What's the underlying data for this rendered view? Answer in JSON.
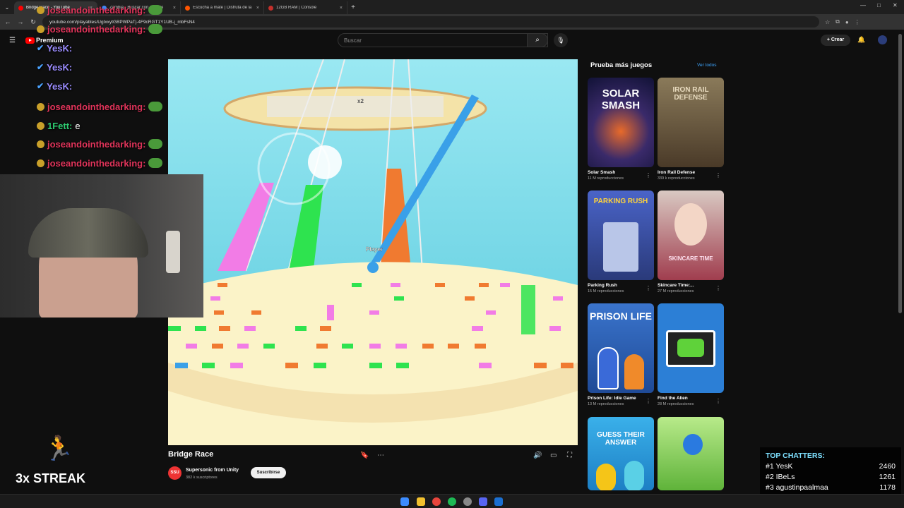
{
  "browser": {
    "tabs": [
      {
        "label": "Bridge Race - YouTube",
        "color": "#ff0000",
        "active": true
      },
      {
        "label": "Zambia - Buscar con Google",
        "color": "#4285f4",
        "active": false
      },
      {
        "label": "Escucha a mate | Disfruta de la",
        "color": "#ff5500",
        "active": false
      },
      {
        "label": "12GB RAM | Console",
        "color": "#c4302b",
        "active": false
      }
    ],
    "url": "youtube.com/playables/UgIxxytGBPWPaTj-4F9cRGT1Y1UB-j_mbFsN4"
  },
  "youtube": {
    "search_placeholder": "Buscar",
    "premium_label": "Premium",
    "create_label": "Crear",
    "video_title": "Bridge Race",
    "channel_name": "Supersonic from Unity",
    "channel_subs": "382 k suscriptores",
    "channel_avatar_text": "SSU",
    "subscribe_label": "Suscribirse",
    "more_games_title": "Prueba más juegos",
    "see_all": "Ver todos",
    "games": [
      {
        "name": "Solar Smash",
        "plays": "11 M reproducciones",
        "thumb_text": "SOLAR SMASH",
        "bg": "#1b1f4a"
      },
      {
        "name": "Iron Rail Defense",
        "plays": "339 k reproducciones",
        "thumb_text": "IRON RAIL DEFENSE",
        "bg": "#6a5a44"
      },
      {
        "name": "Parking Rush",
        "plays": "15 M reproducciones",
        "thumb_text": "PARKING RUSH",
        "bg": "#3a4e9c"
      },
      {
        "name": "Skincare Time:...",
        "plays": "27 M reproducciones",
        "thumb_text": "SKINCARE TIME",
        "bg": "#b34a5a"
      },
      {
        "name": "Prison Life: Idle Game",
        "plays": "13 M reproducciones",
        "thumb_text": "PRISON LIFE",
        "bg": "#2a5fb0"
      },
      {
        "name": "Find the Alien",
        "plays": "28 M reproducciones",
        "thumb_text": "",
        "bg": "#2c7fd6"
      },
      {
        "name": "",
        "plays": "",
        "thumb_text": "GUESS THEIR ANSWER",
        "bg": "#2aa0e0"
      },
      {
        "name": "",
        "plays": "",
        "thumb_text": "",
        "bg": "#6ec24a"
      }
    ]
  },
  "game": {
    "labels": [
      "x2",
      "Player"
    ]
  },
  "stream": {
    "chat": [
      {
        "user": "joseandointhedarking:",
        "color": "#e0345a",
        "badge": "coin",
        "msg": ""
      },
      {
        "user": "joseandointhedarking:",
        "color": "#e0345a",
        "badge": "coin",
        "msg": ""
      },
      {
        "user": "YesK:",
        "color": "#9b8cff",
        "badge": "check",
        "msg": ""
      },
      {
        "user": "YesK:",
        "color": "#9b8cff",
        "badge": "check",
        "msg": ""
      },
      {
        "user": "YesK:",
        "color": "#9b8cff",
        "badge": "check",
        "msg": ""
      },
      {
        "user": "joseandointhedarking:",
        "color": "#e0345a",
        "badge": "coin",
        "msg": ""
      },
      {
        "user": "1Fett:",
        "color": "#2ecc71",
        "badge": "coin",
        "msg": " e"
      },
      {
        "user": "joseandointhedarking:",
        "color": "#e0345a",
        "badge": "coin",
        "msg": ""
      },
      {
        "user": "joseandointhedarking:",
        "color": "#e0345a",
        "badge": "coin",
        "msg": ""
      }
    ],
    "streak": "3x STREAK",
    "top_chatters_title": "TOP CHATTERS:",
    "top_chatters": [
      {
        "rank": "#1",
        "name": "YesK",
        "count": "2460"
      },
      {
        "rank": "#2",
        "name": "IBeLs",
        "count": "1261"
      },
      {
        "rank": "#3",
        "name": "agustinpaalmaa",
        "count": "1178"
      }
    ]
  }
}
